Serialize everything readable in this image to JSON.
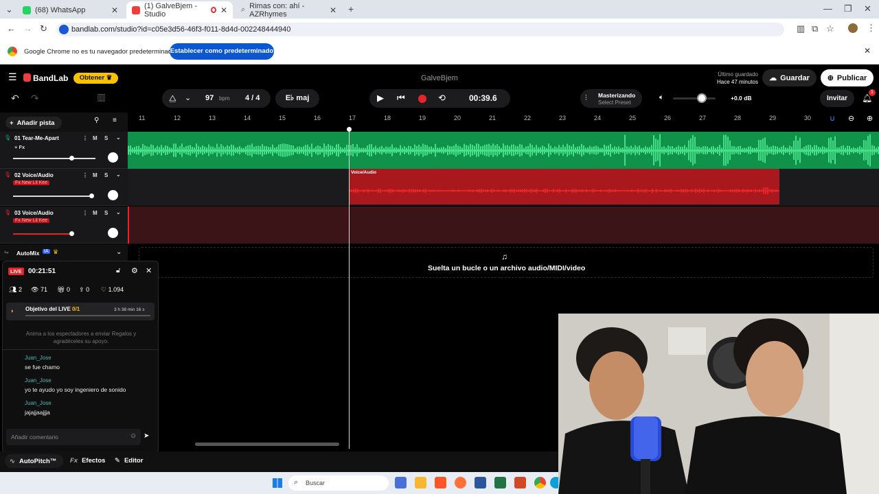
{
  "browser": {
    "tabs": [
      {
        "label": "(68) WhatsApp",
        "active": false
      },
      {
        "label": "(1) GalveBjem - Studio",
        "active": true
      },
      {
        "label": "Rimas con: ahí - AZRhymes",
        "active": false
      }
    ],
    "url": "bandlab.com/studio?id=c05e3d56-46f3-f011-8d4d-002248444940",
    "infobar_text": "Google Chrome no es tu navegador predeterminado",
    "infobar_button": "Establecer como predeterminado"
  },
  "app": {
    "logo": "BandLab",
    "obtener": "Obtener",
    "project_title": "GalveBjem",
    "last_saved_label": "Último guardado",
    "last_saved_time": "Hace 47 minutos",
    "save_label": "Guardar",
    "publish_label": "Publicar"
  },
  "toolbar": {
    "bpm_value": "97",
    "bpm_unit": "bpm",
    "time_signature": "4 / 4",
    "key": "E♭ maj",
    "time_display": "00:39.6",
    "mastering_title": "Masterizando",
    "mastering_preset": "Select Preset",
    "volume_db": "+0.0 dB",
    "invite_label": "Invitar",
    "notif_count": "1"
  },
  "add_track_label": "Añadir pista",
  "ruler": [
    "11",
    "12",
    "13",
    "14",
    "15",
    "16",
    "17",
    "18",
    "19",
    "20",
    "21",
    "22",
    "23",
    "24",
    "25",
    "26",
    "27",
    "28",
    "29",
    "30"
  ],
  "tracks": [
    {
      "name": "01  Tear-Me-Apart",
      "fx": "+ Fx",
      "color": "#1aa85a"
    },
    {
      "name": "02  Voice/Audio",
      "fx": "Fx New Lil Kee",
      "color": "#b3171c"
    },
    {
      "name": "03  Voice/Audio",
      "fx": "Fx New Lil Kee",
      "color": "#5a1d1f"
    }
  ],
  "clip_label": "Voice/Audio",
  "ms": {
    "m": "M",
    "s": "S"
  },
  "automix": {
    "label": "AutoMix",
    "badge": "IA"
  },
  "drop_zone": "Suelta un bucle o un archivo audio/MIDI/video",
  "live": {
    "badge": "LIVE",
    "timer": "00:21:51",
    "stats": {
      "users": "2",
      "views": "71",
      "gifts": "0",
      "shares": "0",
      "likes": "1.094"
    },
    "goal_label": "Objetivo del LIVE",
    "goal_progress": "0/1",
    "goal_time": "3 h 38 min 16 s",
    "hint": "Anima a los espectadores a enviar Regalos y agradéceles su apoyo.",
    "messages": [
      {
        "user": "Juan_Jose",
        "text": "se fue chamo"
      },
      {
        "user": "Juan_Jose",
        "text": "yo te ayudo yo soy ingeniero de sonido"
      },
      {
        "user": "Juan_Jose",
        "text": "jajajjaajjja"
      }
    ],
    "comment_placeholder": "Añadir comentario"
  },
  "bottom": {
    "autopitch": "AutoPitch™",
    "effects": "Efectos",
    "editor": "Editor"
  },
  "taskbar": {
    "search_placeholder": "Buscar"
  }
}
